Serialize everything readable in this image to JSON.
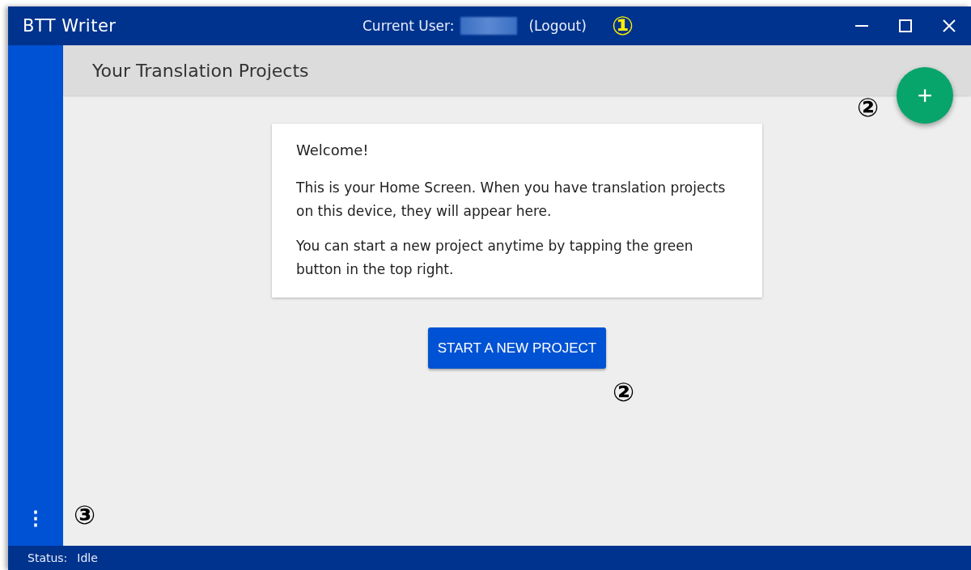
{
  "window": {
    "title": "BTT Writer",
    "user_label": "Current User:",
    "logout": "(Logout)",
    "controls": [
      {
        "kind": "minimize"
      },
      {
        "kind": "maximize"
      },
      {
        "kind": "close"
      }
    ]
  },
  "header": {
    "title": "Your Translation Projects"
  },
  "add_button": {
    "label": "+"
  },
  "welcome_card": {
    "heading": "Welcome!",
    "paragraphs": [
      "This is your Home Screen. When you have translation projects on this device, they will appear here.",
      "You can start a new project anytime by tapping the green button in the top right."
    ]
  },
  "start_button": {
    "label": "START A NEW PROJECT"
  },
  "sidebar": {
    "menu": "⋮"
  },
  "status_bar": {
    "label": "Status:",
    "value": "Idle"
  },
  "callouts": [
    {
      "label": "①",
      "kind": "title"
    },
    {
      "label": "②",
      "kind": "add"
    },
    {
      "label": "②",
      "kind": "start"
    },
    {
      "label": "③",
      "kind": "menu"
    }
  ]
}
